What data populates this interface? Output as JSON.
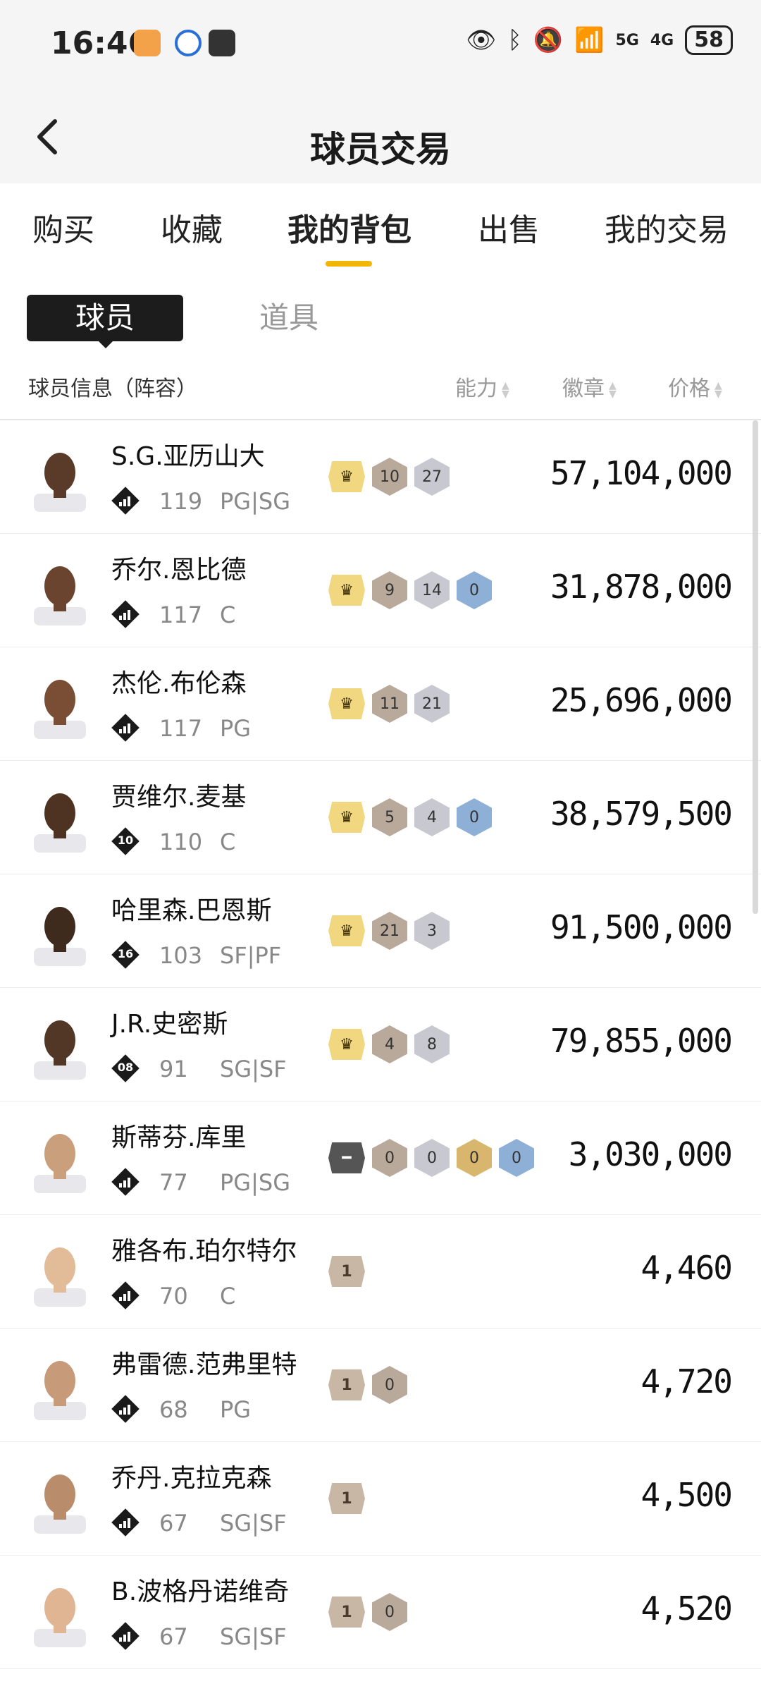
{
  "status_bar": {
    "time": "16:46",
    "battery": "58",
    "signal1": "5G",
    "signal2": "4G"
  },
  "header": {
    "title": "球员交易"
  },
  "tabs": [
    {
      "label": "购买"
    },
    {
      "label": "收藏"
    },
    {
      "label": "我的背包",
      "active": true
    },
    {
      "label": "出售"
    },
    {
      "label": "我的交易"
    }
  ],
  "segment": {
    "active": "球员",
    "inactive": "道具"
  },
  "list_header": {
    "info": "球员信息（阵容）",
    "ability": "能力",
    "badge": "徽章",
    "price": "价格"
  },
  "players": [
    {
      "name": "S.G.亚历山大",
      "level_icon": "bars",
      "ovr": "119",
      "pos": "PG|SG",
      "tier": "crown",
      "badges": [
        {
          "v": "10",
          "c": "bronze"
        },
        {
          "v": "27",
          "c": "silver"
        }
      ],
      "price": "57,104,000"
    },
    {
      "name": "乔尔.恩比德",
      "level_icon": "bars",
      "ovr": "117",
      "pos": "C",
      "tier": "crown",
      "badges": [
        {
          "v": "9",
          "c": "bronze"
        },
        {
          "v": "14",
          "c": "silver"
        },
        {
          "v": "0",
          "c": "blue"
        }
      ],
      "price": "31,878,000"
    },
    {
      "name": "杰伦.布伦森",
      "level_icon": "bars",
      "ovr": "117",
      "pos": "PG",
      "tier": "crown",
      "badges": [
        {
          "v": "11",
          "c": "bronze"
        },
        {
          "v": "21",
          "c": "silver"
        }
      ],
      "price": "25,696,000"
    },
    {
      "name": "贾维尔.麦基",
      "level_icon": "10",
      "ovr": "110",
      "pos": "C",
      "tier": "crown",
      "badges": [
        {
          "v": "5",
          "c": "bronze"
        },
        {
          "v": "4",
          "c": "silver"
        },
        {
          "v": "0",
          "c": "blue"
        }
      ],
      "price": "38,579,500"
    },
    {
      "name": "哈里森.巴恩斯",
      "level_icon": "16",
      "ovr": "103",
      "pos": "SF|PF",
      "tier": "crown",
      "badges": [
        {
          "v": "21",
          "c": "bronze"
        },
        {
          "v": "3",
          "c": "silver"
        }
      ],
      "price": "91,500,000"
    },
    {
      "name": "J.R.史密斯",
      "level_icon": "08",
      "ovr": "91",
      "pos": "SG|SF",
      "tier": "crown",
      "badges": [
        {
          "v": "4",
          "c": "bronze"
        },
        {
          "v": "8",
          "c": "silver"
        }
      ],
      "price": "79,855,000"
    },
    {
      "name": "斯蒂芬.库里",
      "level_icon": "bars",
      "ovr": "77",
      "pos": "PG|SG",
      "tier": "dash",
      "badges": [
        {
          "v": "0",
          "c": "bronze"
        },
        {
          "v": "0",
          "c": "silver"
        },
        {
          "v": "0",
          "c": "gold"
        },
        {
          "v": "0",
          "c": "blue"
        }
      ],
      "price": "3,030,000"
    },
    {
      "name": "雅各布.珀尔特尔",
      "level_icon": "bars",
      "ovr": "70",
      "pos": "C",
      "tier": "1",
      "badges": [],
      "price": "4,460"
    },
    {
      "name": "弗雷德.范弗里特",
      "level_icon": "bars",
      "ovr": "68",
      "pos": "PG",
      "tier": "1",
      "badges": [
        {
          "v": "0",
          "c": "bronze"
        }
      ],
      "price": "4,720"
    },
    {
      "name": "乔丹.克拉克森",
      "level_icon": "bars",
      "ovr": "67",
      "pos": "SG|SF",
      "tier": "1",
      "badges": [],
      "price": "4,500"
    },
    {
      "name": "B.波格丹诺维奇",
      "level_icon": "bars",
      "ovr": "67",
      "pos": "SG|SF",
      "tier": "1",
      "badges": [
        {
          "v": "0",
          "c": "bronze"
        }
      ],
      "price": "4,520"
    }
  ]
}
